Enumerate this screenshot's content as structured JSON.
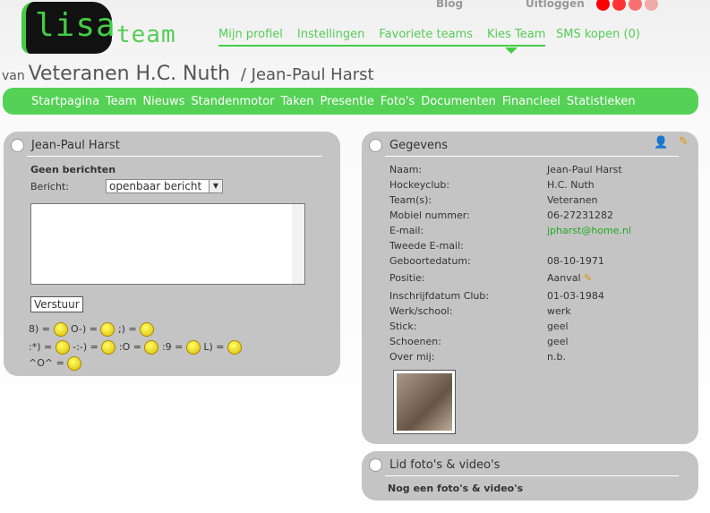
{
  "logo": {
    "text": "lisa",
    "suffix": "team"
  },
  "top_links": {
    "blog": "Blog",
    "logout": "Uitloggen"
  },
  "colors": {
    "accent": "#55d155",
    "panel": "#c4c4c4",
    "dots": [
      "#ff0000",
      "#ff3333",
      "#f77070",
      "#f0aaaa"
    ]
  },
  "nav": [
    "Mijn profiel",
    "Instellingen",
    "Favoriete teams",
    "Kies Team"
  ],
  "sms": "SMS kopen (0)",
  "title": {
    "van": "van",
    "team": "Veteranen H.C. Nuth",
    "player": "/ Jean-Paul Harst"
  },
  "menu": [
    "Startpagina",
    "Team",
    "Nieuws",
    "Standenmotor",
    "Taken",
    "Presentie",
    "Foto's",
    "Documenten",
    "Financieel",
    "Statistieken"
  ],
  "messages": {
    "title": "Jean-Paul Harst",
    "empty": "Geen berichten",
    "label": "Bericht:",
    "select": "openbaar bericht",
    "send": "Verstuur",
    "smileys": {
      "l1": [
        "8) =",
        "O-) =",
        ";) ="
      ],
      "l2": [
        ":*) =",
        "-:-) =",
        ":O =",
        ":9 =",
        "L) ="
      ],
      "l3": [
        "^O^ ="
      ]
    }
  },
  "details": {
    "title": "Gegevens",
    "rows": [
      [
        "Naam:",
        "Jean-Paul Harst"
      ],
      [
        "Hockeyclub:",
        "H.C. Nuth"
      ],
      [
        "Team(s):",
        "Veteranen"
      ],
      [
        "Mobiel nummer:",
        "06-27231282"
      ],
      [
        "E-mail:",
        "jpharst@home.nl"
      ],
      [
        "Tweede E-mail:",
        ""
      ],
      [
        "Geboortedatum:",
        "08-10-1971"
      ],
      [
        "Positie:",
        "Aanval"
      ],
      [
        "Inschrijfdatum Club:",
        "01-03-1984"
      ],
      [
        "Werk/school:",
        "werk"
      ],
      [
        "Stick:",
        "geel"
      ],
      [
        "Schoenen:",
        "geel"
      ],
      [
        "Over mij:",
        "n.b."
      ]
    ]
  },
  "media": {
    "title": "Lid foto's & video's",
    "empty": "Nog een foto's & video's"
  }
}
